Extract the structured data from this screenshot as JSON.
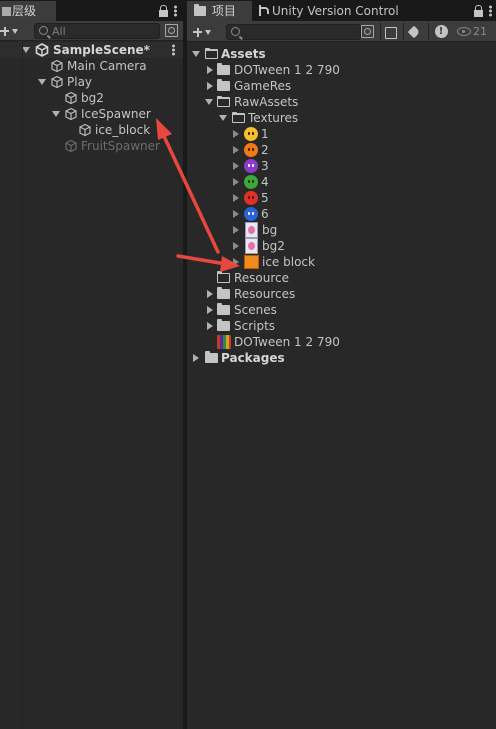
{
  "hierarchy": {
    "tab_label": "层级",
    "search_placeholder": "All",
    "scene": {
      "name": "SampleScene*"
    },
    "items": [
      {
        "label": "Main Camera"
      },
      {
        "label": "Play"
      },
      {
        "label": "bg2"
      },
      {
        "label": "IceSpawner"
      },
      {
        "label": "ice_block"
      },
      {
        "label": "FruitSpawner"
      }
    ]
  },
  "project": {
    "tab_label": "项目",
    "tab2_label": "Unity Version Control",
    "search_placeholder": "",
    "visibility_count": "21",
    "tree": [
      {
        "label": "Assets"
      },
      {
        "label": "DOTween 1 2 790"
      },
      {
        "label": "GameRes"
      },
      {
        "label": "RawAssets"
      },
      {
        "label": "Textures"
      },
      {
        "label": "1"
      },
      {
        "label": "2"
      },
      {
        "label": "3"
      },
      {
        "label": "4"
      },
      {
        "label": "5"
      },
      {
        "label": "6"
      },
      {
        "label": "bg"
      },
      {
        "label": "bg2"
      },
      {
        "label": "ice block"
      },
      {
        "label": "Resource"
      },
      {
        "label": "Resources"
      },
      {
        "label": "Scenes"
      },
      {
        "label": "Scripts"
      },
      {
        "label": "DOTween 1 2 790"
      },
      {
        "label": "Packages"
      }
    ]
  },
  "colors": {
    "panel_bg": "#282828",
    "toolbar_bg": "#3c3c3c",
    "text": "#c4c4c4",
    "annotation_arrow": "#e8473f"
  }
}
